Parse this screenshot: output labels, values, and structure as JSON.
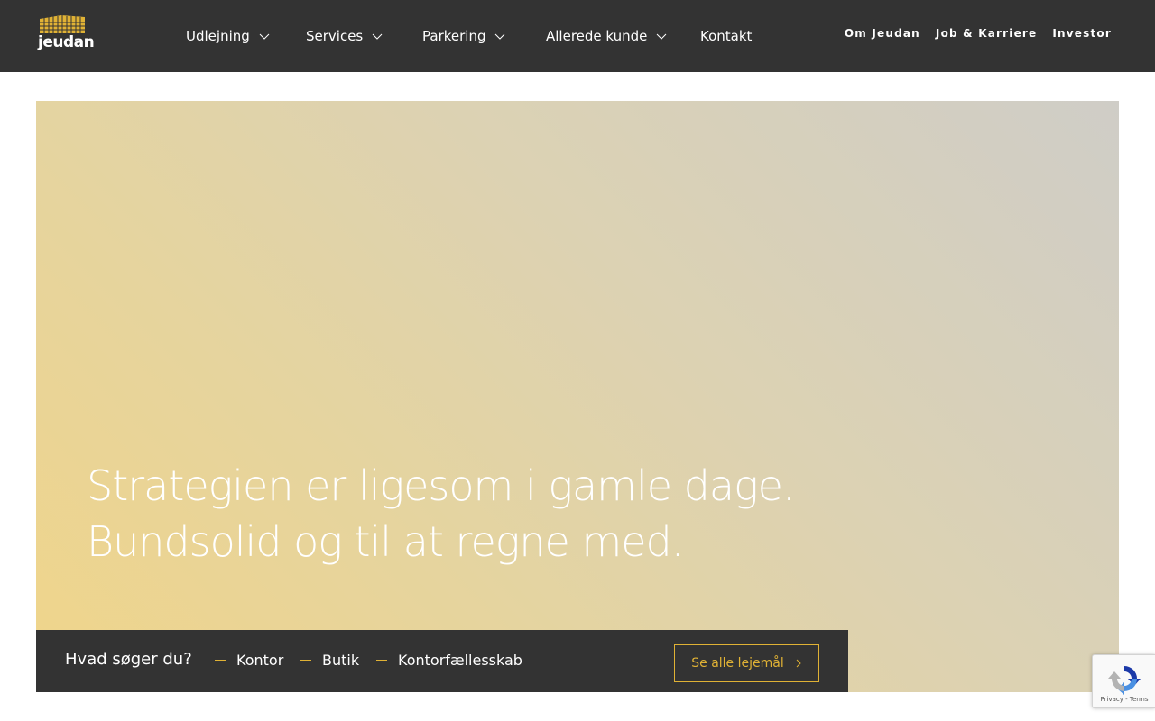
{
  "brand": {
    "logo_text": "jeudan",
    "accent": "#e0b235",
    "dark": "#333333"
  },
  "main_nav": [
    {
      "label": "Udlejning",
      "dropdown": true
    },
    {
      "label": "Services",
      "dropdown": true
    },
    {
      "label": "Parkering",
      "dropdown": true
    },
    {
      "label": "Allerede kunde",
      "dropdown": true
    },
    {
      "label": "Kontakt",
      "dropdown": false
    }
  ],
  "secondary_nav": [
    "Om Jeudan",
    "Job & Karriere",
    "Investor"
  ],
  "hero": {
    "line1": "Strategien er ligesom i gamle dage.",
    "line2": "Bundsolid og til at regne med."
  },
  "search_bar": {
    "question": "Hvad søger du?",
    "categories": [
      "Kontor",
      "Butik",
      "Kontorfællesskab"
    ],
    "see_all_label": "Se alle lejemål"
  },
  "recaptcha": {
    "text": "Privacy - Terms",
    "icon": "recaptcha-icon"
  }
}
